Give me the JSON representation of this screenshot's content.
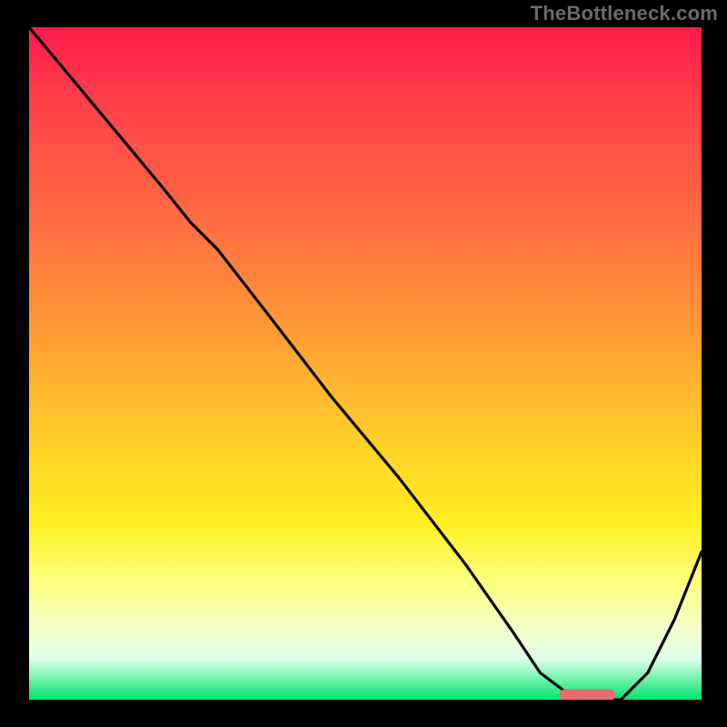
{
  "watermark": "TheBottleneck.com",
  "colors": {
    "curve": "#000000",
    "marker": "#e96a6f"
  },
  "chart_data": {
    "type": "line",
    "title": "",
    "xlabel": "",
    "ylabel": "",
    "xlim": [
      0,
      100
    ],
    "ylim": [
      0,
      100
    ],
    "series": [
      {
        "name": "curve",
        "x": [
          0,
          5,
          10,
          15,
          20,
          24,
          28,
          35,
          45,
          55,
          65,
          72,
          76,
          80,
          84,
          88,
          92,
          96,
          100
        ],
        "y": [
          100,
          94,
          88,
          82,
          76,
          71,
          67,
          58,
          45,
          33,
          20,
          10,
          4,
          1,
          0,
          0,
          4,
          12,
          22
        ]
      }
    ],
    "marker": {
      "x_start": 79,
      "x_end": 87,
      "y": 0.7
    },
    "notes": "Values estimated from pixel positions; y=0 is bottom (green), y=100 is top (red)."
  }
}
